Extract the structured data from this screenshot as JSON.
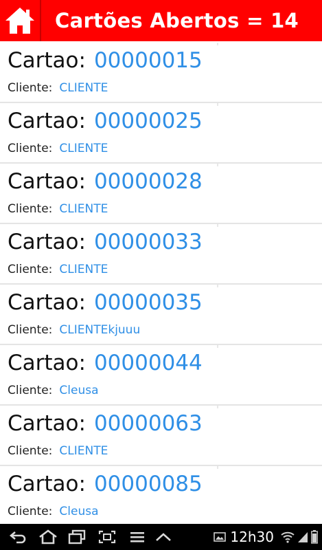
{
  "header": {
    "title": "Cartões Abertos = 14",
    "home_icon": "home-icon",
    "background_color": "#ff0000"
  },
  "cards": [
    {
      "card_label": "Cartao:",
      "card_number": "00000015",
      "client_label": "Cliente:",
      "client_name": "CLIENTE"
    },
    {
      "card_label": "Cartao:",
      "card_number": "00000025",
      "client_label": "Cliente:",
      "client_name": "CLIENTE"
    },
    {
      "card_label": "Cartao:",
      "card_number": "00000028",
      "client_label": "Cliente:",
      "client_name": "CLIENTE"
    },
    {
      "card_label": "Cartao:",
      "card_number": "00000033",
      "client_label": "Cliente:",
      "client_name": "CLIENTE"
    },
    {
      "card_label": "Cartao:",
      "card_number": "00000035",
      "client_label": "Cliente:",
      "client_name": "CLIENTEkjuuu"
    },
    {
      "card_label": "Cartao:",
      "card_number": "00000044",
      "client_label": "Cliente:",
      "client_name": "Cleusa"
    },
    {
      "card_label": "Cartao:",
      "card_number": "00000063",
      "client_label": "Cliente:",
      "client_name": "CLIENTE"
    },
    {
      "card_label": "Cartao:",
      "card_number": "00000085",
      "client_label": "Cliente:",
      "client_name": "Cleusa"
    }
  ],
  "colors": {
    "accent_blue": "#2f8fe6",
    "header_red": "#ff0000"
  },
  "system_bar": {
    "clock": "12h30",
    "nav_icons": [
      "back-icon",
      "home-nav-icon",
      "recent-apps-icon",
      "screenshot-icon",
      "menu-icon",
      "up-chevron-icon"
    ],
    "status_icons": [
      "gallery-notification-icon",
      "wifi-icon",
      "signal-icon",
      "battery-icon"
    ]
  }
}
